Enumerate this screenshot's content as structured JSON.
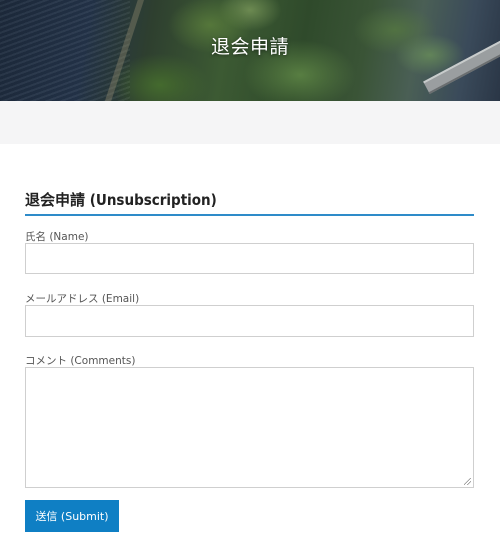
{
  "hero": {
    "title": "退会申請"
  },
  "form": {
    "heading": "退会申請 (Unsubscription)",
    "name": {
      "label": "氏名 (Name)",
      "value": "",
      "placeholder": ""
    },
    "email": {
      "label": "メールアドレス (Email)",
      "value": "",
      "placeholder": ""
    },
    "comments": {
      "label": "コメント (Comments)",
      "value": "",
      "placeholder": ""
    },
    "submit_label": "送信 (Submit)"
  },
  "colors": {
    "accent": "#2e8bc9",
    "button": "#0f7fc4",
    "band": "#f5f5f6"
  }
}
